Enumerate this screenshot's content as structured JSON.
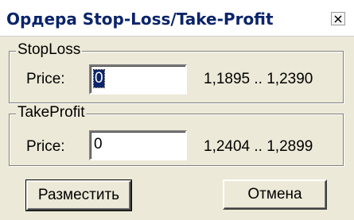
{
  "window": {
    "title": "Ордера Stop-Loss/Take-Profit",
    "close_icon": "close-icon"
  },
  "stoploss": {
    "group_label": "StopLoss",
    "price_label": "Price:",
    "price_value": "0",
    "range": "1,1895 .. 1,2390"
  },
  "takeprofit": {
    "group_label": "TakeProfit",
    "price_label": "Price:",
    "price_value": "0",
    "range": "1,2404 .. 1,2899"
  },
  "buttons": {
    "place_label": "Разместить",
    "cancel_label": "Отмена"
  },
  "colors": {
    "dialog_bg": "#ece9d8",
    "title_text": "#0a246a",
    "selection": "#0a246a"
  }
}
